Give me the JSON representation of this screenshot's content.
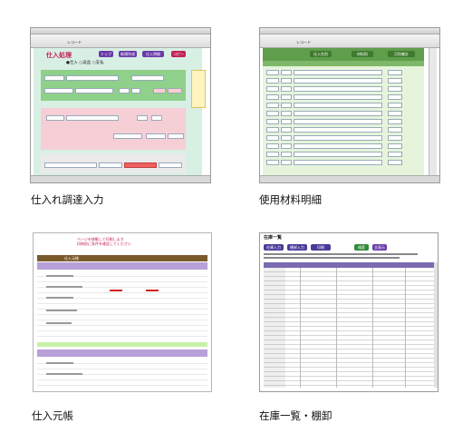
{
  "captions": {
    "purchase_entry": "仕入れ調達入力",
    "material_detail": "使用材料明細",
    "purchase_ledger": "仕入元帳",
    "inventory_list": "在庫一覧・棚卸"
  },
  "purchase_entry": {
    "title": "仕入処理",
    "btn_top": "トップ",
    "btn_new": "新規作成",
    "btn_detail": "仕入明細",
    "btn_copy": "コピー",
    "radio_options": [
      "仕入",
      "返品",
      "支払"
    ],
    "toolbar_record": "レコード"
  },
  "material_detail": {
    "toolbar_record": "レコード",
    "tab_labels": [
      "仕入先別",
      "材料別",
      "月別集計"
    ]
  },
  "purchase_ledger": {
    "header_text": "仕入元帳",
    "note_lines": [
      "ページを移動して印刷します",
      "印刷前に条件を確認してください"
    ]
  },
  "inventory_list": {
    "title": "在庫一覧",
    "buttons": [
      "在庫入力",
      "棚卸入力",
      "印刷",
      "検索",
      "全表示"
    ],
    "button_colors": [
      "#4a3a9a",
      "#4a3a9a",
      "#4a3a9a",
      "#2f8a3a",
      "#6a3aaa"
    ]
  }
}
